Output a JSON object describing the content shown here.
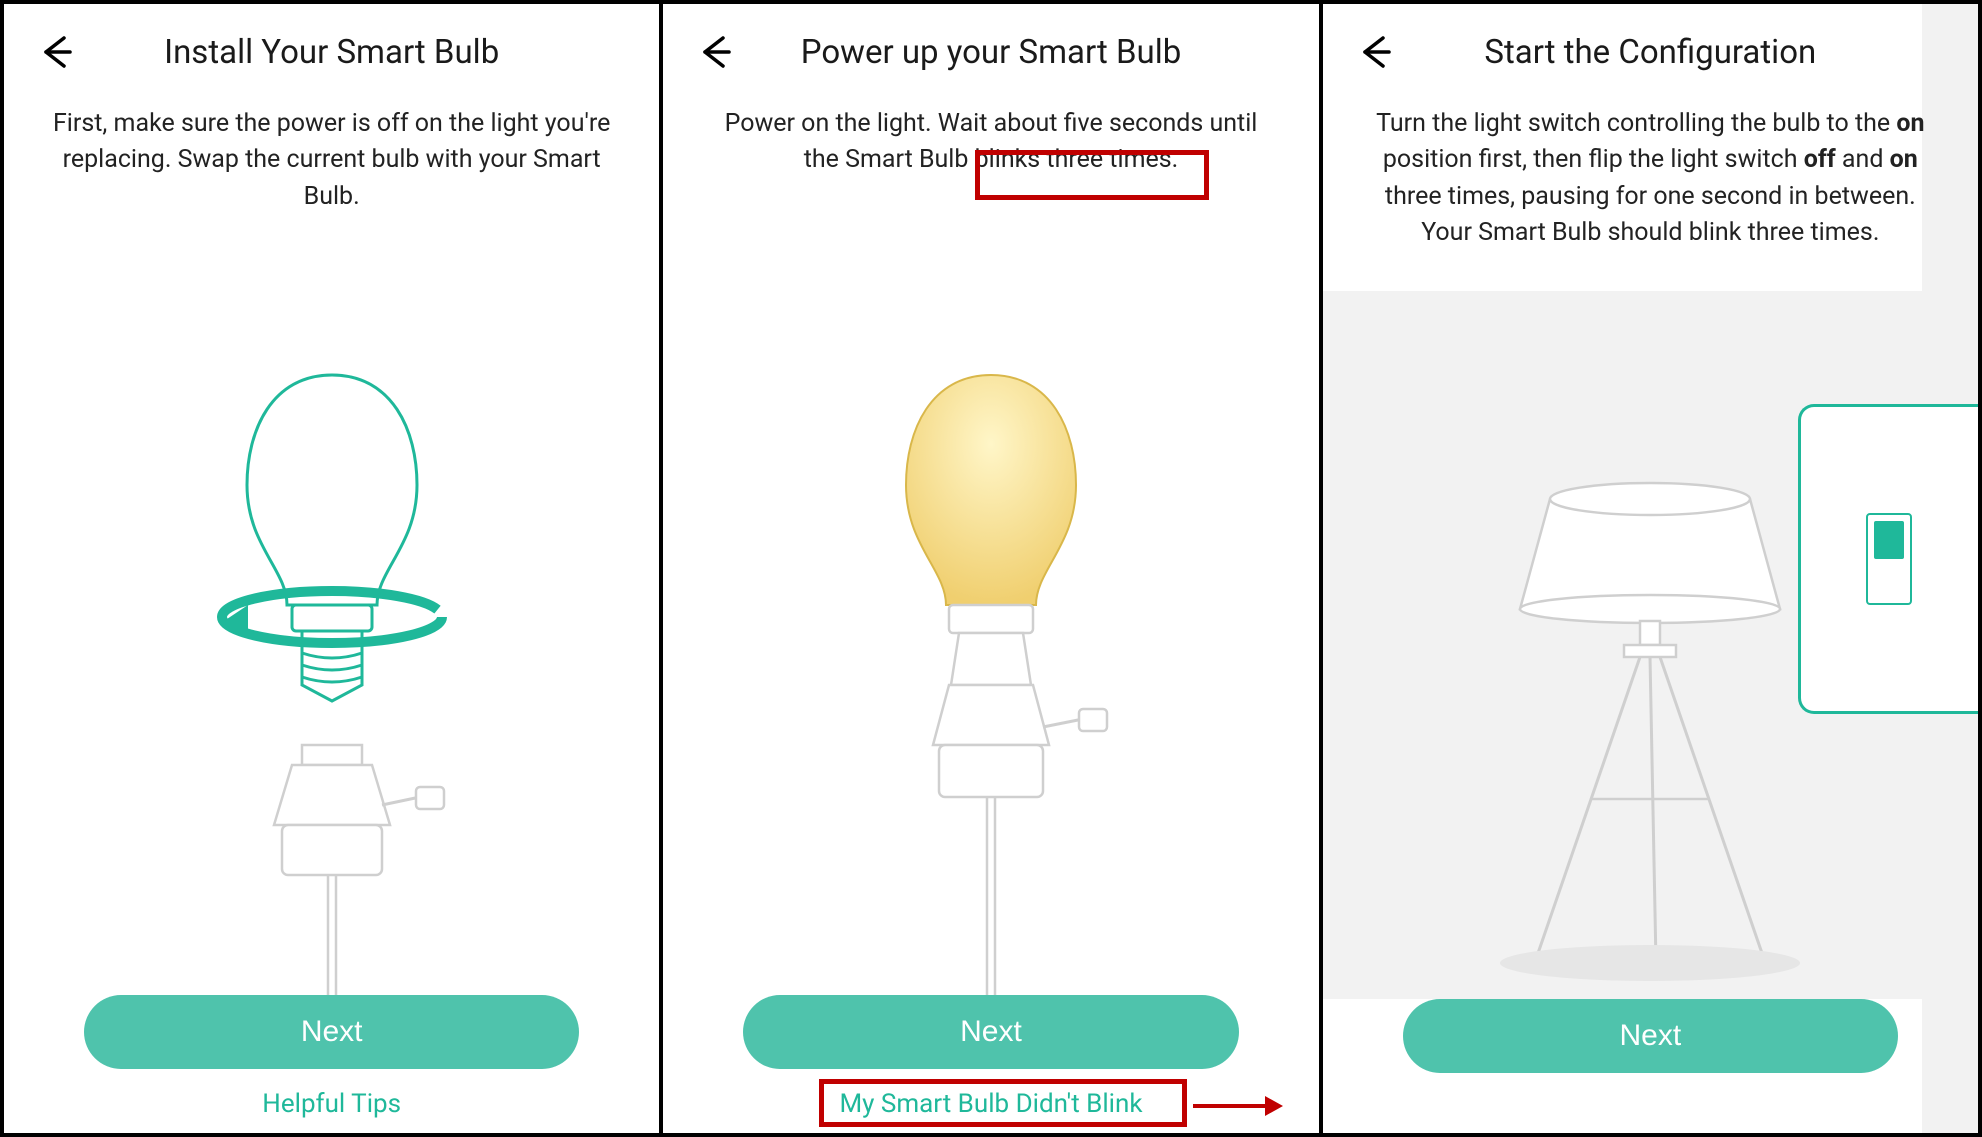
{
  "accent_color": "#4fc3ac",
  "link_color": "#1fb89a",
  "highlight_color": "#c00000",
  "panels": [
    {
      "title": "Install Your Smart Bulb",
      "description_plain": "First, make sure the power is off on the light you're replacing. Swap the current bulb with your Smart Bulb.",
      "next_label": "Next",
      "link_label": "Helpful Tips"
    },
    {
      "title": "Power up your Smart Bulb",
      "description_plain": "Power on the light. Wait about five seconds until the Smart Bulb blinks three times.",
      "highlighted_phrase": "blinks three times.",
      "next_label": "Next",
      "link_label": "My Smart Bulb Didn't Blink"
    },
    {
      "title": "Start the Configuration",
      "description_segments": [
        {
          "text": "Turn the light switch controlling the bulb to the ",
          "bold": false
        },
        {
          "text": "on",
          "bold": true
        },
        {
          "text": " position first, then flip the light switch ",
          "bold": false
        },
        {
          "text": "off",
          "bold": true
        },
        {
          "text": " and ",
          "bold": false
        },
        {
          "text": "on",
          "bold": true
        },
        {
          "text": " three times, pausing for one second in between. Your Smart Bulb should blink three times.",
          "bold": false
        }
      ],
      "next_label": "Next"
    }
  ],
  "icons": {
    "back": "back-arrow-icon",
    "bulb_install": "bulb-install-illustration",
    "bulb_glow": "bulb-glowing-illustration",
    "lamp": "floor-lamp-illustration",
    "switch": "wall-switch-icon"
  }
}
